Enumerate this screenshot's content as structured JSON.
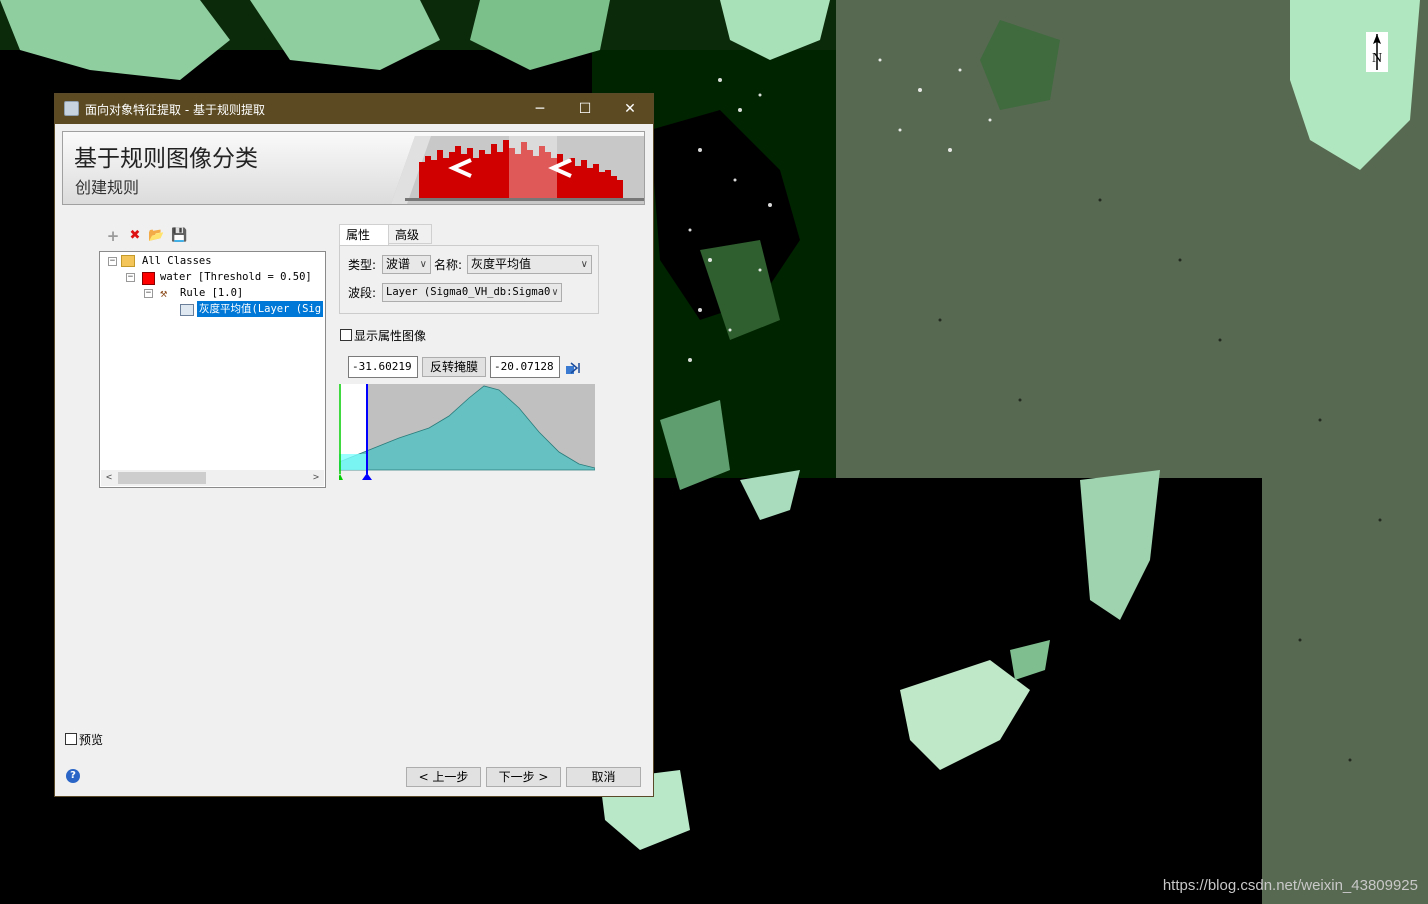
{
  "window": {
    "title": "面向对象特征提取 - 基于规则提取",
    "minimize_glyph": "─",
    "maximize_glyph": "☐",
    "close_glyph": "✕"
  },
  "banner": {
    "title": "基于规则图像分类",
    "subtitle": "创建规则"
  },
  "toolbar": {
    "icons": [
      "add-icon",
      "delete-icon",
      "open-folder-icon",
      "save-icon"
    ],
    "add_glyph": "+",
    "delete_glyph": "✖",
    "open_glyph": "📂",
    "save_glyph": "💾"
  },
  "tree": {
    "root": "All Classes",
    "class": "water [Threshold = 0.50]",
    "class_color": "#ff0000",
    "rule": "Rule [1.0]",
    "attribute": "灰度平均值(Layer (Sig",
    "collapse_glyph": "−",
    "scroll_left": "<",
    "scroll_right": ">"
  },
  "tabs": [
    "属性",
    "高级"
  ],
  "properties": {
    "type_label": "类型:",
    "type_value": "波谱",
    "name_label": "名称:",
    "name_value": "灰度平均值",
    "band_label": "波段:",
    "band_value": "Layer (Sigma0_VH_db:Sigma0",
    "dropdown_glyph": "∨"
  },
  "show_attribute_image": {
    "label": "显示属性图像",
    "checked": false
  },
  "threshold": {
    "min": "-31.60219",
    "invert_button": "反转掩膜",
    "max": "-20.07128"
  },
  "preview": {
    "label": "预览",
    "checked": false
  },
  "footer": {
    "help_glyph": "?",
    "back": "< 上一步",
    "next": "下一步 >",
    "cancel": "取消"
  },
  "watermark": "https://blog.csdn.net/weixin_43809925",
  "north_arrow_label": "N",
  "colors": {
    "title_bar": "#5b4a22",
    "selection": "#0078d7",
    "histogram_fill": "#66c2c2",
    "histogram_bg": "#c0c0c0",
    "marker": "#0000ff",
    "map_green": "#576950",
    "map_dark": "#002400"
  }
}
